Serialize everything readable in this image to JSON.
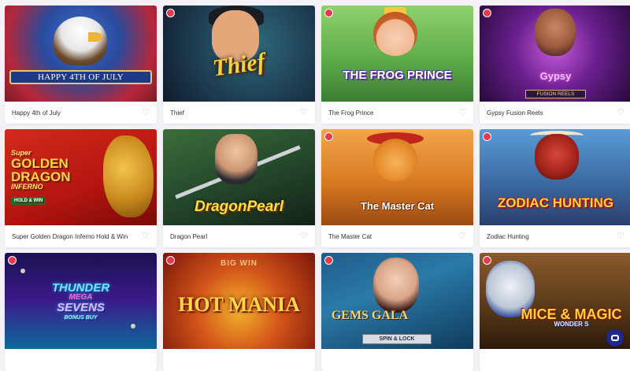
{
  "games": [
    {
      "name": "Happy 4th of July",
      "art_text": "HAPPY 4TH OF JULY"
    },
    {
      "name": "Thief",
      "art_text": "Thief"
    },
    {
      "name": "The Frog Prince",
      "art_text": "THE FROG PRINCE"
    },
    {
      "name": "Gypsy Fusion Reels",
      "art_text": "Gypsy",
      "art_sub": "FUSION REELS"
    },
    {
      "name": "Super Golden Dragon Inferno Hold & Win",
      "art_pre": "Super",
      "art_text": "GOLDEN DRAGON",
      "art_sub": "INFERNO",
      "art_badge": "HOLD & WIN"
    },
    {
      "name": "Dragon Pearl",
      "art_text": "DragonPearl"
    },
    {
      "name": "The Master Cat",
      "art_text": "The Master Cat"
    },
    {
      "name": "Zodiac Hunting",
      "art_text": "ZODIAC HUNTING"
    },
    {
      "name": "",
      "art_text": "THUNDER",
      "art_mid": "MEGA",
      "art_sub": "SEVENS",
      "art_badge": "BONUS BUY"
    },
    {
      "name": "",
      "art_top": "BIG WIN",
      "art_text": "HOT MANIA"
    },
    {
      "name": "",
      "art_text": "GEMS GALA",
      "art_badge": "SPIN & LOCK"
    },
    {
      "name": "",
      "art_text": "MICE & MAGIC",
      "art_sub": "WONDER S"
    }
  ],
  "icons": {
    "favorite": "heart-icon",
    "chat": "chat-icon",
    "badge": "provider-badge-icon"
  },
  "colors": {
    "page_bg": "#f4f2f6",
    "heart": "#d9a3c4",
    "chat_button": "#1d2a8c"
  }
}
